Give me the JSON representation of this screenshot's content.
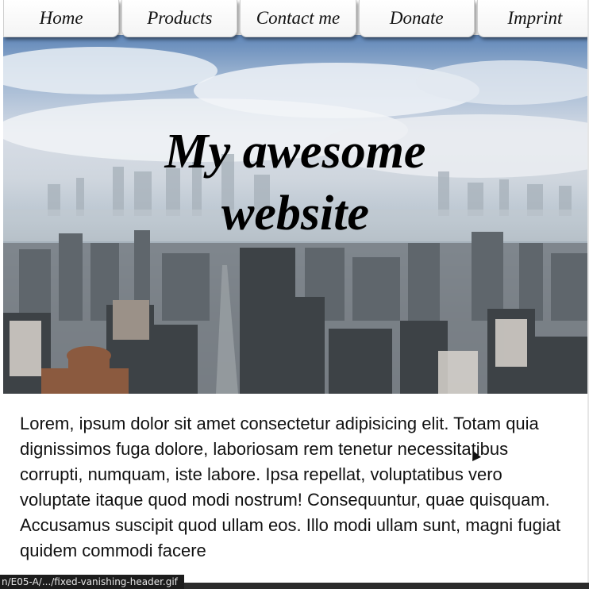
{
  "nav": {
    "items": [
      {
        "label": "Home"
      },
      {
        "label": "Products"
      },
      {
        "label": "Contact me"
      },
      {
        "label": "Donate"
      },
      {
        "label": "Imprint"
      }
    ]
  },
  "hero": {
    "title_line1": "My awesome",
    "title_line2": "website"
  },
  "content": {
    "paragraph": "Lorem, ipsum dolor sit amet consectetur adipisicing elit. Totam quia dignissimos fuga dolore, laboriosam rem tenetur necessitatibus corrupti, numquam, iste labore. Ipsa repellat, voluptatibus vero voluptate itaque quod modi nostrum! Consequuntur, quae quisquam. Accusamus suscipit quod ullam eos. Illo modi ullam sunt, magni fugiat quidem commodi facere"
  },
  "status": {
    "url": "n/E05-A/.../fixed-vanishing-header.gif"
  }
}
